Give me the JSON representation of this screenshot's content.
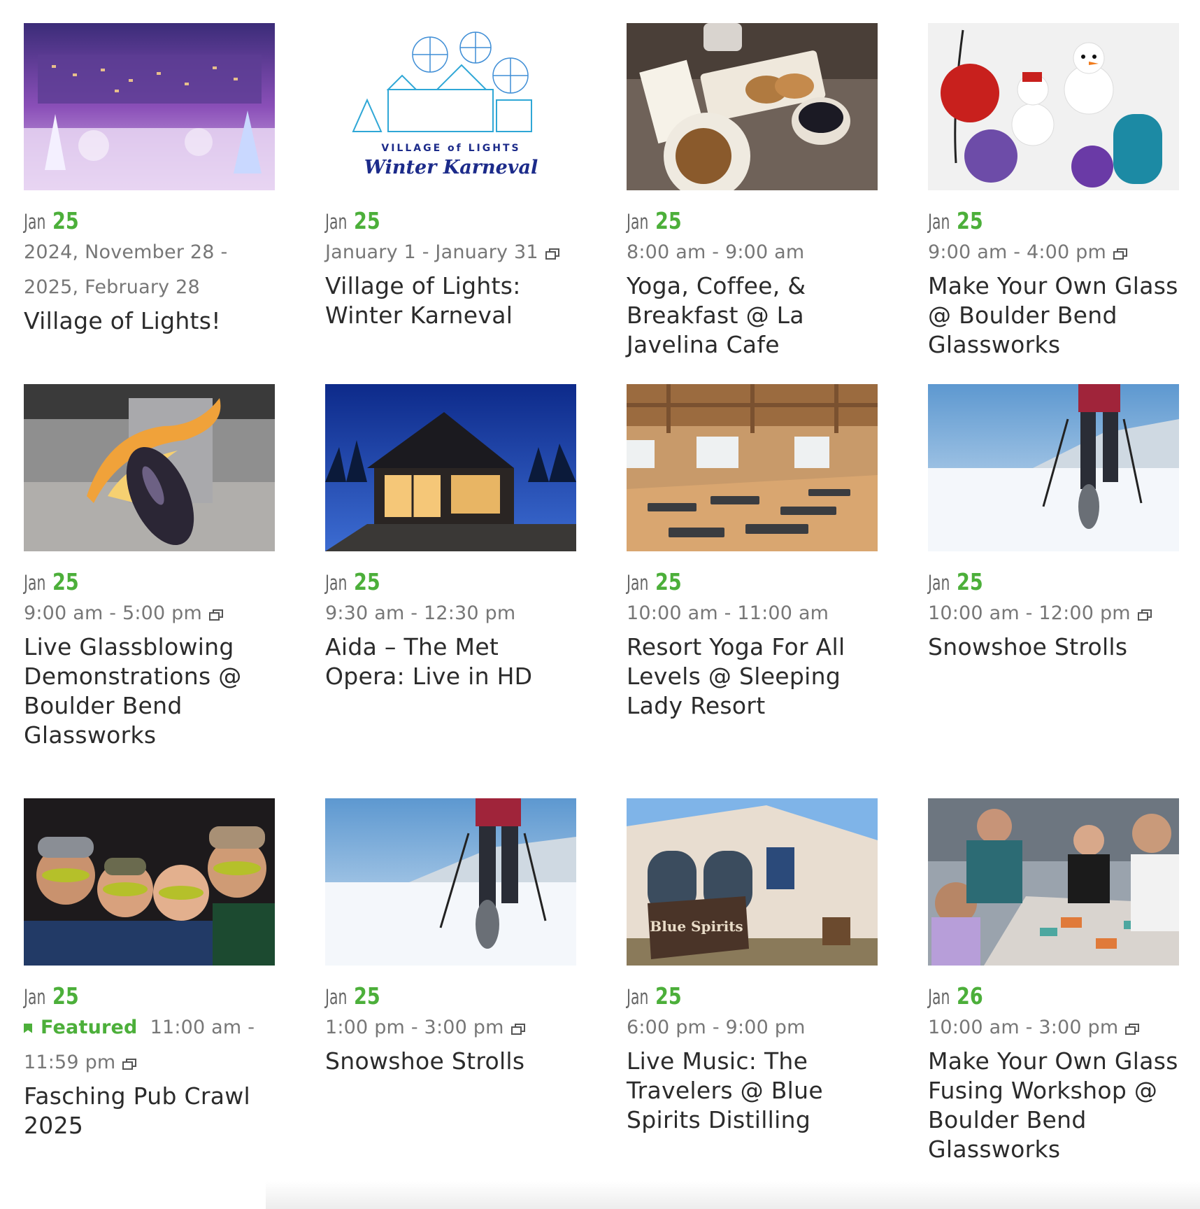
{
  "events": [
    {
      "month": "Jan",
      "day": "25",
      "time": "2024, November 28 - 2025, February 28",
      "recurring": false,
      "featured": false,
      "title": "Village of Lights!",
      "image": "village-night-lights"
    },
    {
      "month": "Jan",
      "day": "25",
      "time": "January 1 - January 31",
      "recurring": true,
      "featured": false,
      "title": "Village of Lights: Winter Karneval",
      "image": "winter-karneval-logo",
      "logo_top": "VILLAGE of LIGHTS",
      "logo_main": "Winter Karneval"
    },
    {
      "month": "Jan",
      "day": "25",
      "time": "8:00 am - 9:00 am",
      "recurring": false,
      "featured": false,
      "title": "Yoga, Coffee, & Breakfast @ La Javelina Cafe",
      "image": "coffee-breakfast"
    },
    {
      "month": "Jan",
      "day": "25",
      "time": "9:00 am - 4:00 pm",
      "recurring": true,
      "featured": false,
      "title": "Make Your Own Glass @ Boulder Bend Glassworks",
      "image": "glass-ornaments"
    },
    {
      "month": "Jan",
      "day": "25",
      "time": "9:00 am - 5:00 pm",
      "recurring": true,
      "featured": false,
      "title": "Live Glassblowing Demonstrations @ Boulder Bend Glassworks",
      "image": "glassblowing-fire"
    },
    {
      "month": "Jan",
      "day": "25",
      "time": "9:30 am - 12:30 pm",
      "recurring": false,
      "featured": false,
      "title": "Aida – The Met Opera: Live in HD",
      "image": "lodge-building-night"
    },
    {
      "month": "Jan",
      "day": "25",
      "time": "10:00 am - 11:00 am",
      "recurring": false,
      "featured": false,
      "title": "Resort Yoga For All Levels @ Sleeping Lady Resort",
      "image": "yoga-hall"
    },
    {
      "month": "Jan",
      "day": "25",
      "time": "10:00 am - 12:00 pm",
      "recurring": true,
      "featured": false,
      "title": "Snowshoe Strolls",
      "image": "snowshoe"
    },
    {
      "month": "Jan",
      "day": "25",
      "time": "11:00 am - 11:59 pm",
      "recurring": true,
      "featured": true,
      "featured_label": "Featured",
      "title": "Fasching Pub Crawl 2025",
      "image": "masked-friends"
    },
    {
      "month": "Jan",
      "day": "25",
      "time": "1:00 pm - 3:00 pm",
      "recurring": true,
      "featured": false,
      "title": "Snowshoe Strolls",
      "image": "snowshoe"
    },
    {
      "month": "Jan",
      "day": "25",
      "time": "6:00 pm - 9:00 pm",
      "recurring": false,
      "featured": false,
      "title": "Live Music: The Travelers @ Blue Spirits Distilling",
      "image": "distillery-front",
      "sign": "Blue Spirits"
    },
    {
      "month": "Jan",
      "day": "26",
      "time": "10:00 am - 3:00 pm",
      "recurring": true,
      "featured": false,
      "title": "Make Your Own Glass Fusing Workshop @ Boulder Bend Glassworks",
      "image": "glass-fusing-workshop"
    }
  ],
  "colors": {
    "accent": "#4caf3a",
    "month": "#666666",
    "time": "#777777",
    "title": "#2b2b2b"
  }
}
